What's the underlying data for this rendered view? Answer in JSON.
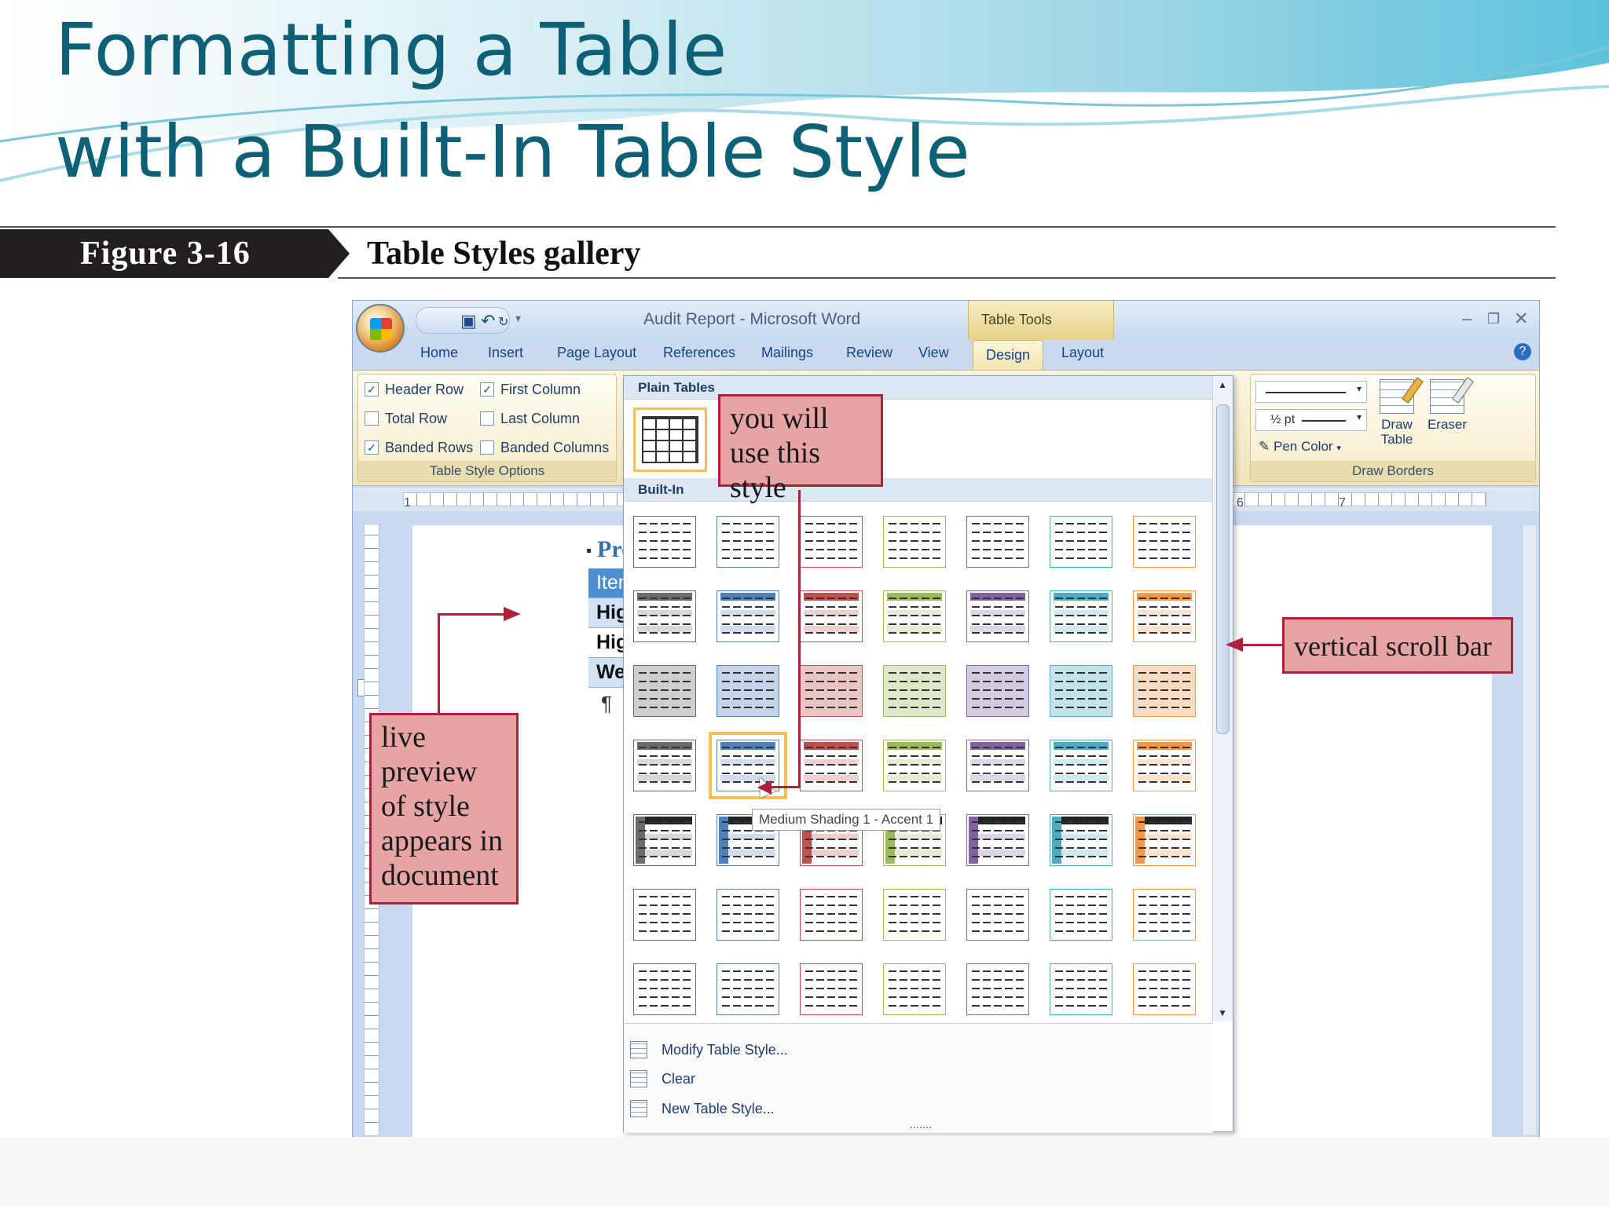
{
  "slide": {
    "title_line1": "Formatting a Table",
    "title_line2": "with a Built-In Table Style",
    "figure_number": "Figure 3-16",
    "figure_caption": "Table Styles gallery"
  },
  "colors": {
    "title": "#0e6076",
    "callout_fill": "#e6a4a4",
    "callout_border": "#b0203a",
    "selection_outline": "#f2c14e"
  },
  "window": {
    "title": "Audit Report - Microsoft Word",
    "contextual_tab_group": "Table Tools",
    "qat_icons": [
      "save-icon",
      "undo-icon",
      "redo-icon",
      "customize-icon"
    ],
    "controls": [
      "minimize",
      "restore",
      "close"
    ],
    "tabs": [
      {
        "label": "Home",
        "active": false
      },
      {
        "label": "Insert",
        "active": false
      },
      {
        "label": "Page Layout",
        "active": false
      },
      {
        "label": "References",
        "active": false
      },
      {
        "label": "Mailings",
        "active": false
      },
      {
        "label": "Review",
        "active": false
      },
      {
        "label": "View",
        "active": false
      },
      {
        "label": "Design",
        "active": true
      },
      {
        "label": "Layout",
        "active": false
      }
    ]
  },
  "ribbon": {
    "style_options": {
      "group_label": "Table Style Options",
      "checkboxes": [
        {
          "label": "Header Row",
          "checked": true
        },
        {
          "label": "First Column",
          "checked": true
        },
        {
          "label": "Total Row",
          "checked": false
        },
        {
          "label": "Last Column",
          "checked": false
        },
        {
          "label": "Banded Rows",
          "checked": true
        },
        {
          "label": "Banded Columns",
          "checked": false
        }
      ]
    },
    "draw_borders": {
      "group_label": "Draw Borders",
      "line_weight": "½ pt",
      "pen_color": "Pen Color",
      "draw_table": "Draw Table",
      "eraser": "Eraser"
    }
  },
  "ruler": {
    "numbers": [
      "1",
      "6",
      "7"
    ]
  },
  "document": {
    "heading": "Probabl",
    "table_rows": [
      "Item¤",
      "High-effici",
      "High-effici",
      "Weather-s"
    ],
    "pilcrow": "¶"
  },
  "gallery": {
    "plain_header": "Plain Tables",
    "builtin_header": "Built-In",
    "accent_colors": [
      "#6b6b6b",
      "#4f81bd",
      "#c0504d",
      "#9bbb59",
      "#8064a2",
      "#4bacc6",
      "#f79646"
    ],
    "selected_style": "Medium Shading 1 - Accent 1",
    "menu": [
      {
        "label": "Modify Table Style...",
        "icon": "modify-style-icon"
      },
      {
        "label": "Clear",
        "icon": "clear-icon"
      },
      {
        "label": "New Table Style...",
        "icon": "new-style-icon"
      }
    ]
  },
  "callouts": {
    "use_style": "you will use this style",
    "scroll_bar": "vertical scroll bar",
    "live_preview": "live preview of style appears in document"
  }
}
